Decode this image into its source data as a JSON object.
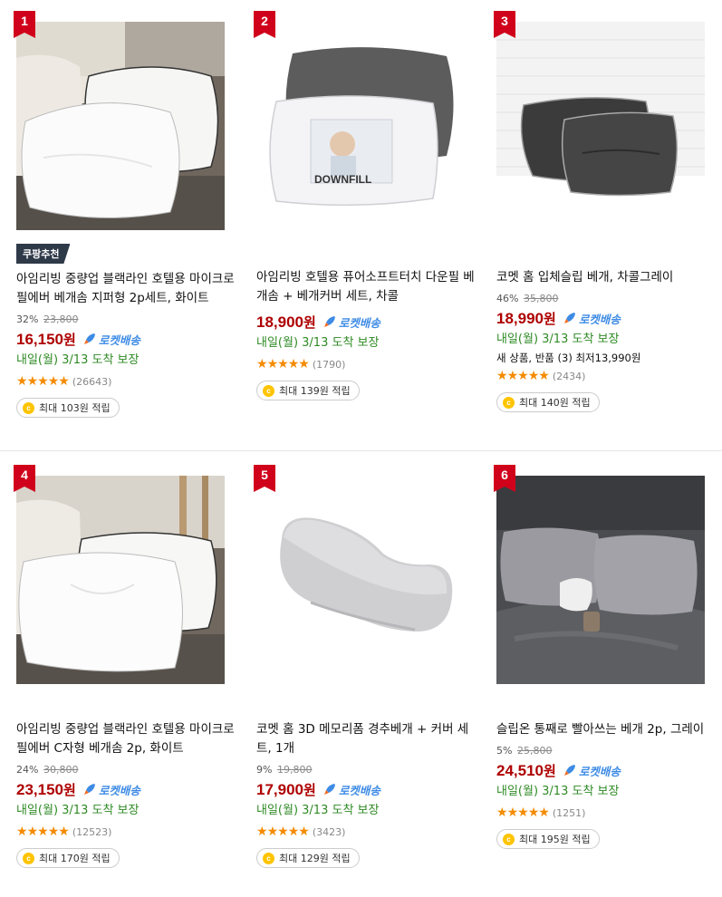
{
  "products": [
    {
      "rank": "1",
      "badge": "쿠팡추천",
      "name": "아임리빙 중량업 블랙라인 호텔용 마이크로필에버 베개솜 지퍼형 2p세트, 화이트",
      "discount": "32%",
      "original_price": "23,800",
      "price": "16,150",
      "price_unit": "원",
      "rocket": "로켓배송",
      "delivery": "내일(월) 3/13 도착 보장",
      "extra": "",
      "rating": 4.5,
      "reviews": "(26643)",
      "points": "최대 103원 적립",
      "image": "white-pillows-bed"
    },
    {
      "rank": "2",
      "badge": "",
      "name": "아임리빙 호텔용 퓨어소프트터치 다운필 베개솜 + 베개커버 세트, 차콜",
      "discount": "",
      "original_price": "",
      "price": "18,900",
      "price_unit": "원",
      "rocket": "로켓배송",
      "delivery": "내일(월) 3/13 도착 보장",
      "extra": "",
      "rating": 4.5,
      "reviews": "(1790)",
      "points": "최대 139원 적립",
      "image": "downfill-pillow",
      "pillow_label": "DOWNFILL"
    },
    {
      "rank": "3",
      "badge": "",
      "name": "코멧 홈 입체슬립 베개, 차콜그레이",
      "discount": "46%",
      "original_price": "35,800",
      "price": "18,990",
      "price_unit": "원",
      "rocket": "로켓배송",
      "delivery": "내일(월) 3/13 도착 보장",
      "extra": "새 상품, 반품 (3) 최저13,990원",
      "rating": 4.5,
      "reviews": "(2434)",
      "points": "최대 140원 적립",
      "image": "charcoal-pillows"
    },
    {
      "rank": "4",
      "badge": "",
      "name": "아임리빙 중량업 블랙라인 호텔용 마이크로필에버 C자형 베개솜 2p, 화이트",
      "discount": "24%",
      "original_price": "30,800",
      "price": "23,150",
      "price_unit": "원",
      "rocket": "로켓배송",
      "delivery": "내일(월) 3/13 도착 보장",
      "extra": "",
      "rating": 4.5,
      "reviews": "(12523)",
      "points": "최대 170원 적립",
      "image": "white-c-pillows"
    },
    {
      "rank": "5",
      "badge": "",
      "name": "코멧 홈 3D 메모리폼 경추베개 + 커버 세트, 1개",
      "discount": "9%",
      "original_price": "19,800",
      "price": "17,900",
      "price_unit": "원",
      "rocket": "로켓배송",
      "delivery": "내일(월) 3/13 도착 보장",
      "extra": "",
      "rating": 4.5,
      "reviews": "(3423)",
      "points": "최대 129원 적립",
      "image": "memory-foam-pillow"
    },
    {
      "rank": "6",
      "badge": "",
      "name": "슬립온 통째로 빨아쓰는 베개 2p, 그레이",
      "discount": "5%",
      "original_price": "25,800",
      "price": "24,510",
      "price_unit": "원",
      "rocket": "로켓배송",
      "delivery": "내일(월) 3/13 도착 보장",
      "extra": "",
      "rating": 4.5,
      "reviews": "(1251)",
      "points": "최대 195원 적립",
      "image": "grey-bedroom-pillows"
    }
  ],
  "colors": {
    "price": "#ae0000",
    "rocket": "#3d8be5",
    "delivery": "#2e8a24",
    "star": "#f48b00",
    "rank": "#d0021b"
  },
  "icons": {
    "rocket": "rocket-icon",
    "coin": "coupang-cash-icon",
    "star": "star-icon"
  }
}
